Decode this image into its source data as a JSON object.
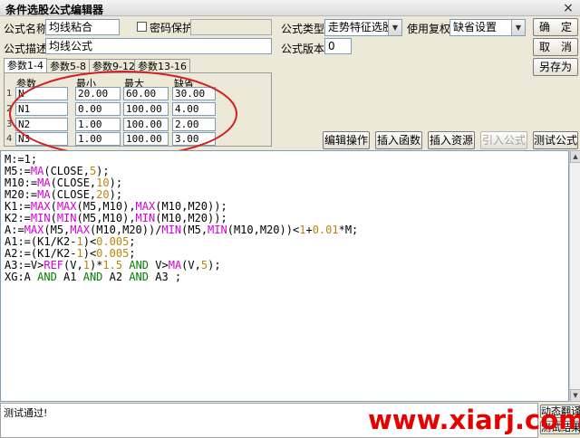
{
  "window": {
    "title": "条件选股公式编辑器",
    "close": "×"
  },
  "form": {
    "name_label": "公式名称",
    "name_value": "均线粘合",
    "password_label": "密码保护",
    "desc_label": "公式描述",
    "desc_value": "均线公式",
    "type_label": "公式类型",
    "type_value": "走势特征选股",
    "version_label": "公式版本",
    "version_value": "0",
    "rights_label": "使用复权",
    "rights_value": "缺省设置"
  },
  "buttons": {
    "ok": "确　定",
    "cancel": "取　消",
    "save_as": "另存为",
    "edit_ops": "编辑操作",
    "insert_func": "插入函数",
    "insert_res": "插入资源",
    "import_formula": "引入公式",
    "test_formula": "测试公式"
  },
  "tabs": [
    {
      "label": "参数1-4",
      "active": true
    },
    {
      "label": "参数5-8",
      "active": false
    },
    {
      "label": "参数9-12",
      "active": false
    },
    {
      "label": "参数13-16",
      "active": false
    }
  ],
  "params": {
    "headers": [
      "参数",
      "最小",
      "最大",
      "缺省"
    ],
    "rows": [
      {
        "num": "1",
        "name": "N",
        "min": "20.00",
        "max": "60.00",
        "def": "30.00"
      },
      {
        "num": "2",
        "name": "N1",
        "min": "0.00",
        "max": "100.00",
        "def": "4.00"
      },
      {
        "num": "3",
        "name": "N2",
        "min": "1.00",
        "max": "100.00",
        "def": "2.00"
      },
      {
        "num": "4",
        "name": "N3",
        "min": "1.00",
        "max": "100.00",
        "def": "3.00"
      }
    ]
  },
  "code": [
    [
      {
        "t": "M:=1;"
      }
    ],
    [
      {
        "t": "M5:="
      },
      {
        "t": "MA",
        "c": "fn"
      },
      {
        "t": "(CLOSE,"
      },
      {
        "t": "5",
        "c": "num"
      },
      {
        "t": ");"
      }
    ],
    [
      {
        "t": "M10:="
      },
      {
        "t": "MA",
        "c": "fn"
      },
      {
        "t": "(CLOSE,"
      },
      {
        "t": "10",
        "c": "num"
      },
      {
        "t": ");"
      }
    ],
    [
      {
        "t": "M20:="
      },
      {
        "t": "MA",
        "c": "fn"
      },
      {
        "t": "(CLOSE,"
      },
      {
        "t": "20",
        "c": "num"
      },
      {
        "t": ");"
      }
    ],
    [
      {
        "t": "K1:="
      },
      {
        "t": "MAX",
        "c": "fn"
      },
      {
        "t": "("
      },
      {
        "t": "MAX",
        "c": "fn"
      },
      {
        "t": "(M5,M10),"
      },
      {
        "t": "MAX",
        "c": "fn"
      },
      {
        "t": "(M10,M20));"
      }
    ],
    [
      {
        "t": "K2:="
      },
      {
        "t": "MIN",
        "c": "fn"
      },
      {
        "t": "("
      },
      {
        "t": "MIN",
        "c": "fn"
      },
      {
        "t": "(M5,M10),"
      },
      {
        "t": "MIN",
        "c": "fn"
      },
      {
        "t": "(M10,M20));"
      }
    ],
    [
      {
        "t": "A:="
      },
      {
        "t": "MAX",
        "c": "fn"
      },
      {
        "t": "(M5,"
      },
      {
        "t": "MAX",
        "c": "fn"
      },
      {
        "t": "(M10,M20))/"
      },
      {
        "t": "MIN",
        "c": "fn"
      },
      {
        "t": "(M5,"
      },
      {
        "t": "MIN",
        "c": "fn"
      },
      {
        "t": "(M10,M20))<"
      },
      {
        "t": "1",
        "c": "num"
      },
      {
        "t": "+"
      },
      {
        "t": "0.01",
        "c": "num"
      },
      {
        "t": "*M;"
      }
    ],
    [
      {
        "t": "A1:=(K1/K2-"
      },
      {
        "t": "1",
        "c": "num"
      },
      {
        "t": ")<"
      },
      {
        "t": "0.005",
        "c": "num"
      },
      {
        "t": ";"
      }
    ],
    [
      {
        "t": "A2:=(K1/K2-"
      },
      {
        "t": "1",
        "c": "num"
      },
      {
        "t": ")<"
      },
      {
        "t": "0.005",
        "c": "num"
      },
      {
        "t": ";"
      }
    ],
    [
      {
        "t": "A3:=V>"
      },
      {
        "t": "REF",
        "c": "fn"
      },
      {
        "t": "(V,"
      },
      {
        "t": "1",
        "c": "num"
      },
      {
        "t": ")*"
      },
      {
        "t": "1.5",
        "c": "num"
      },
      {
        "t": " "
      },
      {
        "t": "AND",
        "c": "kw"
      },
      {
        "t": " V>"
      },
      {
        "t": "MA",
        "c": "fn"
      },
      {
        "t": "(V,"
      },
      {
        "t": "5",
        "c": "num"
      },
      {
        "t": ");"
      }
    ],
    [
      {
        "t": "XG:A "
      },
      {
        "t": "AND",
        "c": "kw"
      },
      {
        "t": " A1 "
      },
      {
        "t": "AND",
        "c": "kw"
      },
      {
        "t": " A2 "
      },
      {
        "t": "AND",
        "c": "kw"
      },
      {
        "t": " A3 ;"
      }
    ]
  ],
  "status": {
    "text": "测试通过!",
    "side_btn1": "动态翻译",
    "side_btn2": "测试结果"
  },
  "watermark": "www.xiarj.com"
}
